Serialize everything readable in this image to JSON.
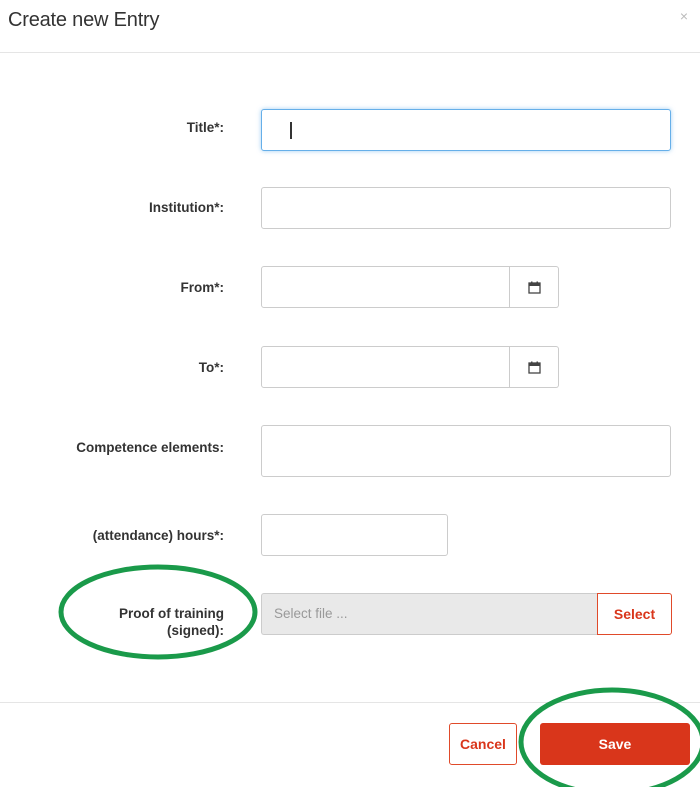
{
  "dialog": {
    "title": "Create new Entry",
    "close_symbol": "×"
  },
  "form": {
    "title_label": "Title*:",
    "institution_label": "Institution*:",
    "from_label": "From*:",
    "to_label": "To*:",
    "competence_label": "Competence elements:",
    "hours_label": "(attendance) hours*:",
    "proof_label_line1": "Proof of training",
    "proof_label_line2": "(signed):",
    "file_placeholder": "Select file ...",
    "select_button": "Select"
  },
  "footer": {
    "cancel_label": "Cancel",
    "save_label": "Save"
  },
  "icons": {
    "calendar": "calendar-icon",
    "close": "close-icon"
  },
  "colors": {
    "accent": "#d9361b",
    "focus": "#66afe9",
    "highlight_circle": "#1a9a4a"
  }
}
